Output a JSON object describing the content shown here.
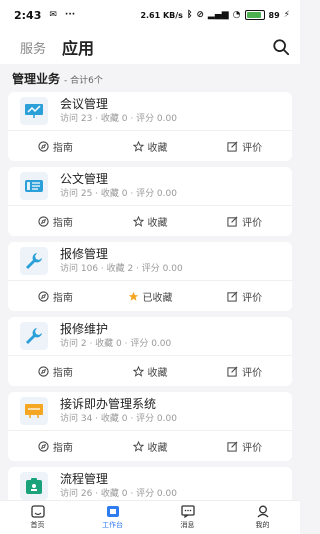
{
  "status_bar": {
    "time": "2:43",
    "network_speed": "2.61 KB/s",
    "battery": "89",
    "battery_level": 0.89
  },
  "header": {
    "tab_service": "服务",
    "tab_apps": "应用"
  },
  "section": {
    "title": "管理业务",
    "count": "- 合计6个"
  },
  "actions": {
    "guide": "指南",
    "favorite": "收藏",
    "favorited": "已收藏",
    "rate": "评价"
  },
  "apps": [
    {
      "name": "会议管理",
      "stats": "访问 23 · 收藏 0 · 评分 0.00",
      "icon": "meeting-icon",
      "favorited": false
    },
    {
      "name": "公文管理",
      "stats": "访问 25 · 收藏 0 · 评分 0.00",
      "icon": "document-icon",
      "favorited": false
    },
    {
      "name": "报修管理",
      "stats": "访问 106 · 收藏 2 · 评分 0.00",
      "icon": "wrench-icon",
      "favorited": true
    },
    {
      "name": "报修维护",
      "stats": "访问 2 · 收藏 0 · 评分 0.00",
      "icon": "wrench-icon",
      "favorited": false
    },
    {
      "name": "接诉即办管理系统",
      "stats": "访问 34 · 收藏 0 · 评分 0.00",
      "icon": "monitor-icon",
      "favorited": false
    },
    {
      "name": "流程管理",
      "stats": "访问 26 · 收藏 0 · 评分 0.00",
      "icon": "workflow-icon",
      "favorited": false
    }
  ],
  "bottom_nav": [
    {
      "label": "首页",
      "icon": "home-icon",
      "active": false
    },
    {
      "label": "工作台",
      "icon": "workbench-icon",
      "active": true
    },
    {
      "label": "消息",
      "icon": "message-icon",
      "active": false
    },
    {
      "label": "我的",
      "icon": "profile-icon",
      "active": false
    }
  ],
  "colors": {
    "accent": "#2f7bf0",
    "icon_blue": "#2a9fd8",
    "icon_orange": "#f5a623",
    "icon_green": "#1aa37a",
    "favorited_star": "#f5a623"
  }
}
